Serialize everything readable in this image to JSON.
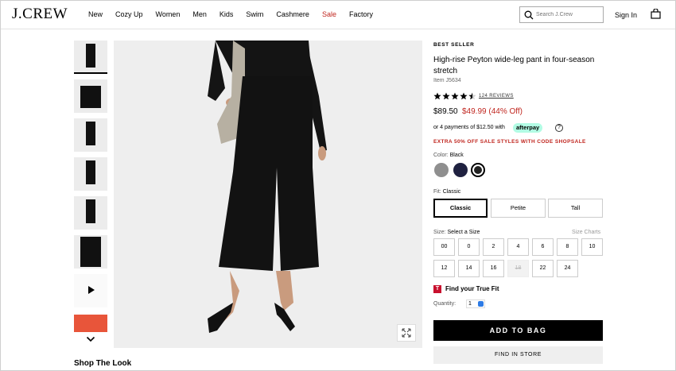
{
  "header": {
    "logo": "J.CREW",
    "nav": [
      "New",
      "Cozy Up",
      "Women",
      "Men",
      "Kids",
      "Swim",
      "Cashmere",
      "Sale",
      "Factory"
    ],
    "sale_color": "#c0261f",
    "search_placeholder": "Search J.Crew",
    "sign_in": "Sign In"
  },
  "gallery": {
    "thumbnails": [
      "front",
      "detail",
      "front-2",
      "side",
      "back",
      "flat",
      "video",
      "orange"
    ],
    "main_image": "model wearing black wide-leg pants and cardigan"
  },
  "shop_the_look": "Shop The Look",
  "product": {
    "badge": "BEST SELLER",
    "title": "High-rise Peyton wide-leg pant in four-season stretch",
    "item": "Item J5634",
    "rating": 4.5,
    "reviews": "124 REVIEWS",
    "price": "$89.50",
    "sale_price": "$49.99 (44% Off)",
    "afterpay_text": "or 4 payments of $12.50 with",
    "afterpay_logo": "afterpay",
    "help": "?",
    "promo": "EXTRA 50% OFF SALE STYLES WITH CODE SHOPSALE",
    "color_label": "Color:",
    "color_value": "Black",
    "swatches": [
      "#8f8f8f",
      "#1f2140",
      "#222222"
    ],
    "fit_label": "Fit:",
    "fit_value": "Classic",
    "fits": [
      "Classic",
      "Petite",
      "Tall"
    ],
    "size_label": "Size:",
    "size_value": "Select a Size",
    "size_charts": "Size Charts",
    "sizes_row1": [
      "00",
      "0",
      "2",
      "4",
      "6",
      "8",
      "10"
    ],
    "sizes_row2": [
      "12",
      "14",
      "16",
      "18",
      "22",
      "24"
    ],
    "truefit_icon": "T",
    "truefit": "Find your True Fit",
    "quantity_label": "Quantity:",
    "quantity": "1",
    "add_to_bag": "ADD TO BAG",
    "find_in_store": "FIND IN STORE"
  }
}
